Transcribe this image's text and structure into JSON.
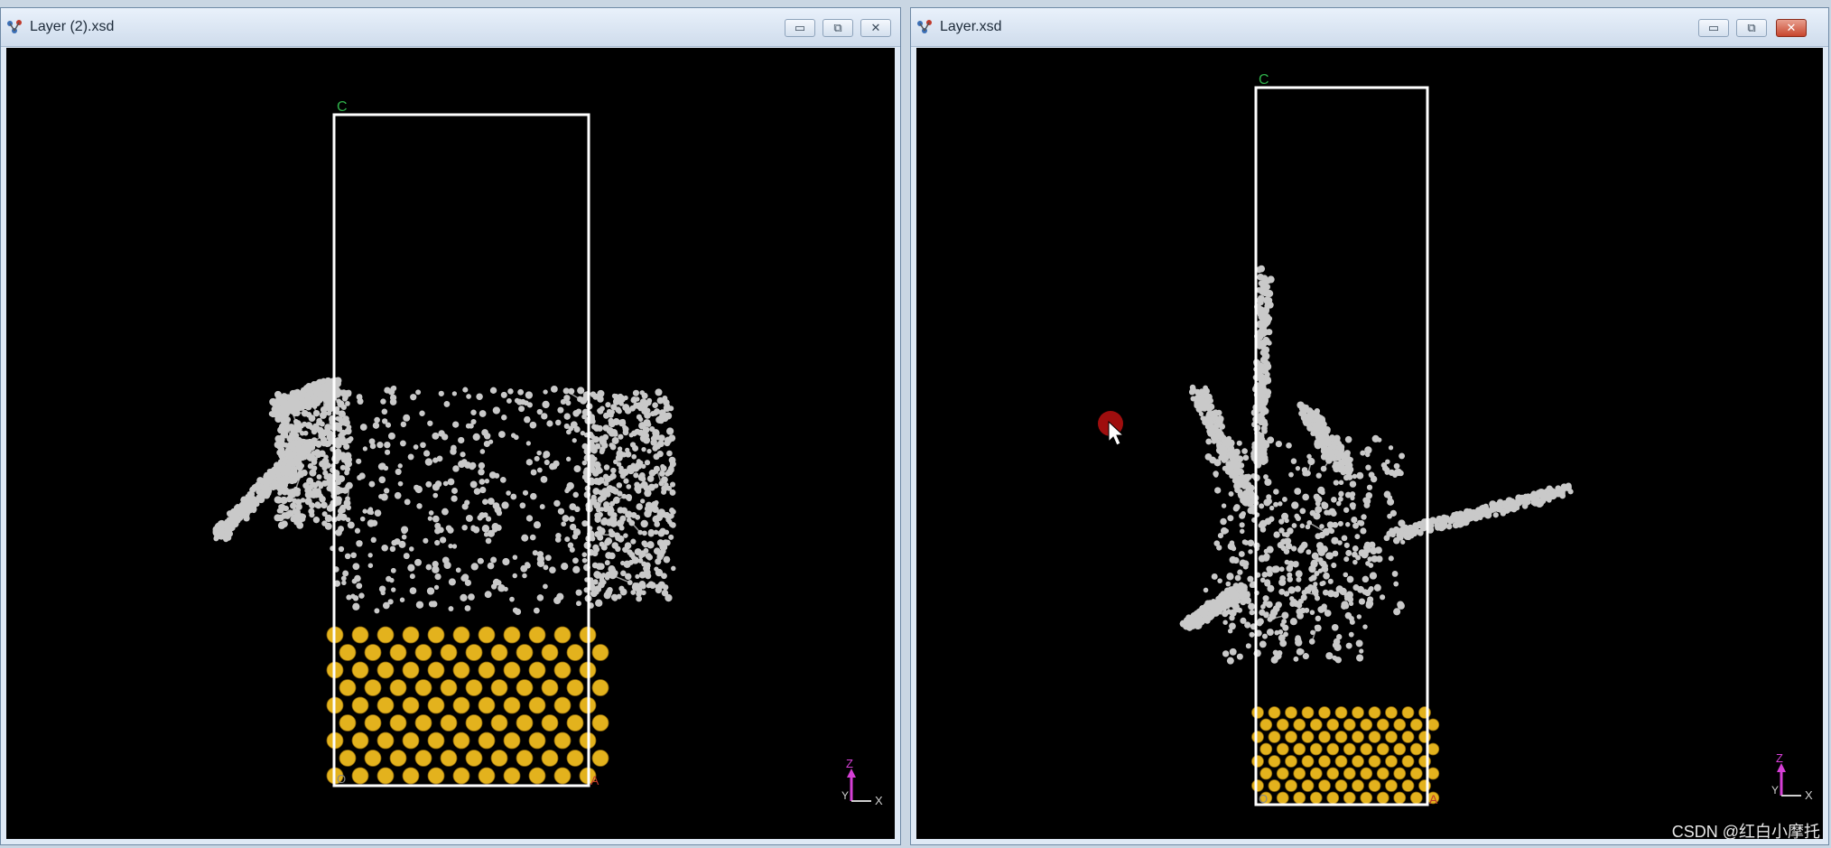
{
  "windows": [
    {
      "title": "Layer (2).xsd",
      "controls": [
        "minimize-icon",
        "restore-icon",
        "close-icon"
      ],
      "cell_labels": {
        "c": "C",
        "a": "A",
        "origin": "O"
      },
      "triad": {
        "z": "Z",
        "y": "Y",
        "x": "X"
      }
    },
    {
      "title": "Layer.xsd",
      "controls": [
        "minimize-icon",
        "restore-icon",
        "close-icon"
      ],
      "cell_labels": {
        "c": "C",
        "a": "A",
        "origin": "O"
      },
      "triad": {
        "z": "Z",
        "y": "Y",
        "x": "X"
      }
    }
  ],
  "colors": {
    "viewport_bg": "#000000",
    "cell_edge": "#ffffff",
    "gold_atom": "#e3b21d",
    "molecule": "#c9c9c9",
    "c_axis_label": "#2fb04a",
    "a_axis_label": "#c0392b",
    "triad_z": "#d63fd6",
    "cursor_highlight": "#b01010"
  },
  "watermark": "CSDN @红白小摩托"
}
